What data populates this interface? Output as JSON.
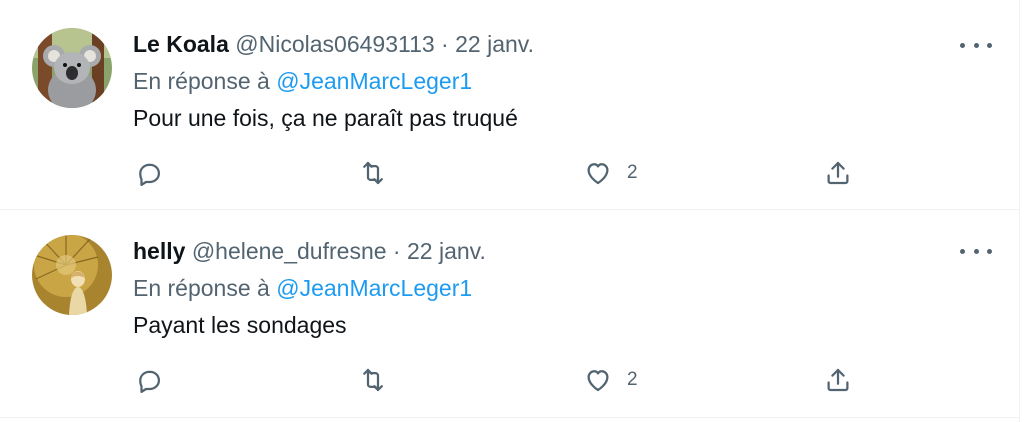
{
  "tweets": [
    {
      "name": "Le Koala",
      "handle": "@Nicolas06493113",
      "dot": "·",
      "date": "22 janv.",
      "reply_prefix": "En réponse à",
      "reply_mention": "@JeanMarcLeger1",
      "text": "Pour une fois, ça ne paraît pas truqué",
      "like_count": "2",
      "avatar_icon": "koala-avatar"
    },
    {
      "name": "helly",
      "handle": "@helene_dufresne",
      "dot": "·",
      "date": "22 janv.",
      "reply_prefix": "En réponse à",
      "reply_mention": "@JeanMarcLeger1",
      "text": "Payant les sondages",
      "like_count": "2",
      "avatar_icon": "parasol-woman-avatar"
    }
  ],
  "icons": {
    "reply": "comment-icon",
    "retweet": "retweet-icon",
    "like": "heart-icon",
    "share": "share-icon",
    "more": "more-icon"
  },
  "colors": {
    "accent": "#1d9bf0",
    "secondary_text": "#536471",
    "primary_text": "#0f1419",
    "divider": "#eff3f4"
  }
}
